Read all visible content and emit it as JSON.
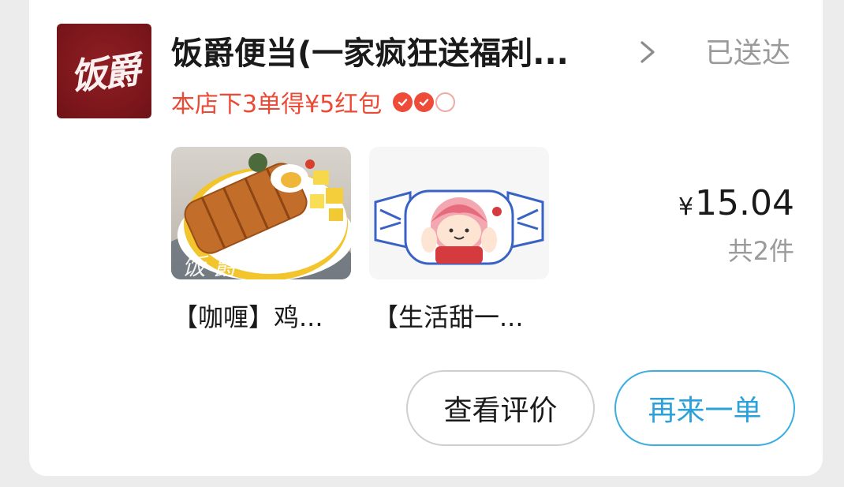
{
  "order": {
    "shop": {
      "logo_text": "饭爵",
      "logo_mark": "®",
      "name": "饭爵便当(一家疯狂送福利...",
      "status": "已送达",
      "promo": "本店下3单得¥5红包",
      "orders_progress": {
        "completed": 2,
        "required": 3
      },
      "chevron_icon": "chevron-right-icon"
    },
    "items": [
      {
        "name": "【咖喱】鸡...",
        "image": "curry-chicken-cutlet-rice-bowl"
      },
      {
        "name": "【生活甜一...",
        "image": "candy-wrapper-cartoon-girl"
      }
    ],
    "price_symbol": "¥",
    "price_value": "15.04",
    "item_count": "共2件",
    "actions": {
      "review": "查看评价",
      "reorder": "再来一单"
    },
    "colors": {
      "brand_red": "#7a161b",
      "promo_red": "#ea4b37",
      "accent_blue": "#2ba1d9",
      "muted_gray": "#9a9a9a"
    }
  }
}
